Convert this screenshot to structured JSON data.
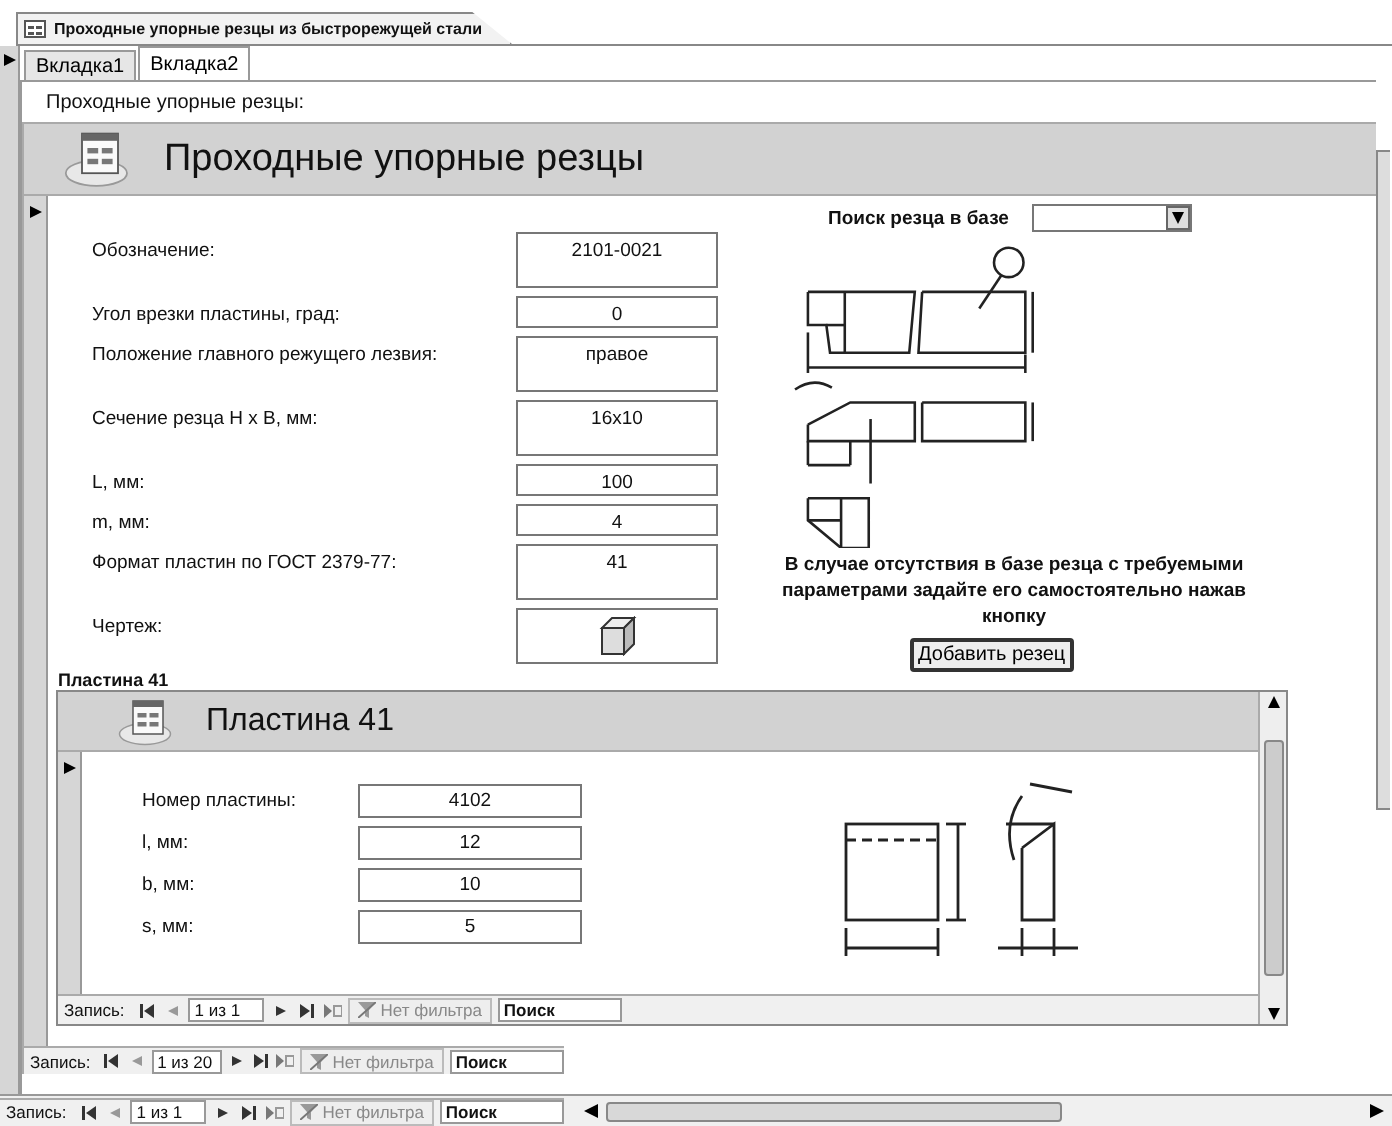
{
  "document_tab": {
    "title": "Проходные упорные резцы из быстрорежущей стали",
    "selected": true
  },
  "tabs": [
    {
      "label": "Вкладка1",
      "selected": false
    },
    {
      "label": "Вкладка2",
      "selected": true
    }
  ],
  "section_label": "Проходные упорные резцы:",
  "form": {
    "title": "Проходные упорные резцы",
    "fields": [
      {
        "kind": "memo",
        "label": "Обозначение:",
        "value": "2101-0021"
      },
      {
        "kind": "text",
        "label": "Угол врезки пластины, град:",
        "value": "0"
      },
      {
        "kind": "memo",
        "label": "Положение главного режущего лезвия:",
        "value": "правое"
      },
      {
        "kind": "memo",
        "label": "Сечение резца H x B, мм:",
        "value": "16x10"
      },
      {
        "kind": "text",
        "label": "L, мм:",
        "value": "100"
      },
      {
        "kind": "text",
        "label": "m, мм:",
        "value": "4"
      },
      {
        "kind": "memo",
        "label": "Формат пластин по ГОСТ 2379-77:",
        "value": "41"
      },
      {
        "kind": "image",
        "label": "Чертеж:"
      }
    ],
    "search": {
      "label": "Поиск резца в базе"
    },
    "note": "В случае отсутствия в базе резца с требуемыми параметрами задайте его самостоятельно нажав  кнопку",
    "add_button": "Добавить резец",
    "subform_label": "Пластина 41",
    "subform": {
      "title": "Пластина 41",
      "fields": [
        {
          "label": "Номер пластины:",
          "value": "4102"
        },
        {
          "label": "l, мм:",
          "value": "12"
        },
        {
          "label": "b, мм:",
          "value": "10"
        },
        {
          "label": "s, мм:",
          "value": "5"
        }
      ],
      "navigation": {
        "label": "Запись:",
        "position": "1 из 1",
        "filter": "Нет фильтра",
        "search": "Поиск"
      }
    }
  },
  "navigation": {
    "label": "Запись:",
    "position": "1 из 20",
    "filter": "Нет фильтра",
    "search": "Поиск"
  },
  "bottom_navigation": {
    "label": "Запись:",
    "position": "1 из 1",
    "filter": "Нет фильтра",
    "search": "Поиск"
  }
}
